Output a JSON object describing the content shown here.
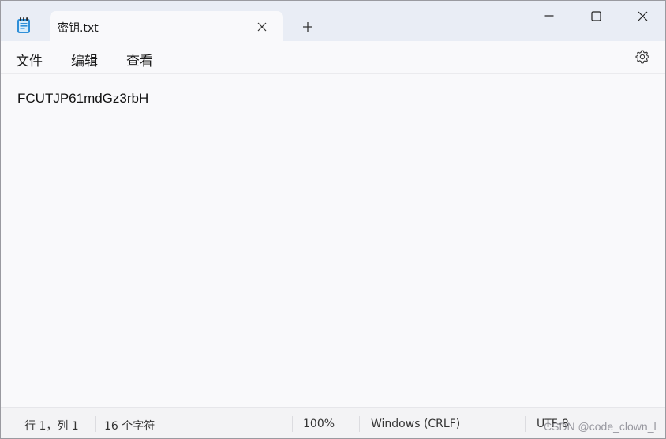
{
  "tab": {
    "title": "密钥.txt"
  },
  "menu": {
    "file": "文件",
    "edit": "编辑",
    "view": "查看"
  },
  "editor": {
    "content": "FCUTJP61mdGz3rbH"
  },
  "status": {
    "position": "行 1，列 1",
    "char_count": "16 个字符",
    "zoom": "100%",
    "line_ending": "Windows (CRLF)",
    "encoding": "UTF-8"
  },
  "watermark": "CSDN @code_clown_l",
  "icons": {
    "app": "notepad-icon",
    "tab_close": "close-icon",
    "new_tab": "plus-icon",
    "minimize": "minimize-icon",
    "maximize": "maximize-icon",
    "close": "close-icon",
    "settings": "gear-icon"
  },
  "colors": {
    "titlebar": "#e9edf5",
    "editor_bg": "#f9f9fb",
    "app_icon_blue": "#2f8fd8"
  }
}
